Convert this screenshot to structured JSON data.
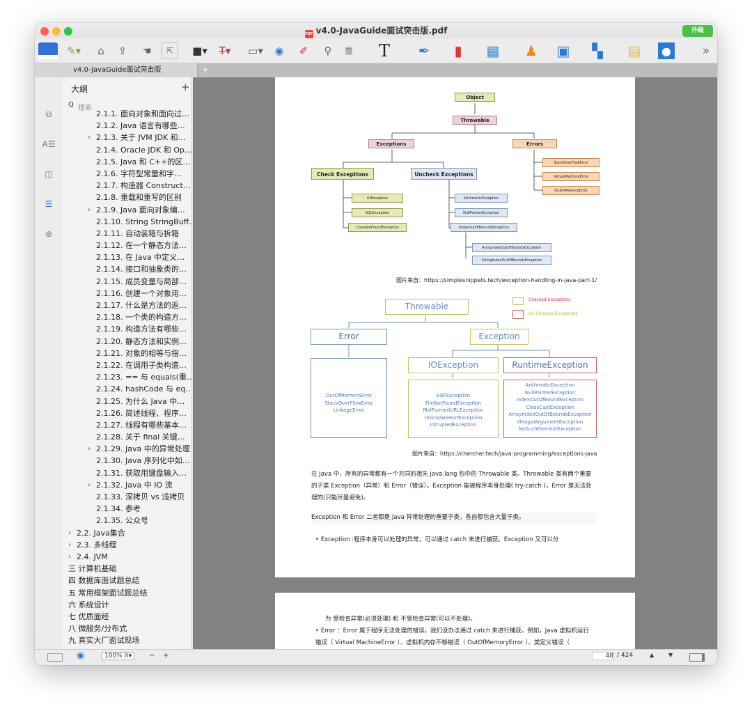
{
  "window": {
    "title": "v4.0-JavaGuide面试突击版.pdf",
    "upgrade": "升级"
  },
  "toolbar": {
    "more": "»",
    "text_tool": "T"
  },
  "tab": {
    "label": "v4.0-JavaGuide面试突击版",
    "plus": "+"
  },
  "sidebar": {
    "outline_title": "大纲",
    "plus": "+",
    "search_placeholder": "搜索",
    "items": [
      {
        "label": "2.1.1. 面向对象和面向过…",
        "indent": 2,
        "chevron": false
      },
      {
        "label": "2.1.2. Java 语言有哪些…",
        "indent": 2,
        "chevron": false
      },
      {
        "label": "2.1.3. 关于 JVM JDK 和…",
        "indent": 2,
        "chevron": true
      },
      {
        "label": "2.1.4. Oracle JDK 和 Op…",
        "indent": 2,
        "chevron": false
      },
      {
        "label": "2.1.5. Java 和 C++的区…",
        "indent": 2,
        "chevron": false
      },
      {
        "label": "2.1.6. 字符型常量和字…",
        "indent": 2,
        "chevron": false
      },
      {
        "label": "2.1.7. 构造器 Construct…",
        "indent": 2,
        "chevron": false
      },
      {
        "label": "2.1.8. 重载和重写的区别",
        "indent": 2,
        "chevron": false
      },
      {
        "label": "2.1.9. Java 面向对象编…",
        "indent": 2,
        "chevron": true
      },
      {
        "label": "2.1.10. String StringBuff…",
        "indent": 2,
        "chevron": false
      },
      {
        "label": "2.1.11. 自动装箱与拆箱",
        "indent": 2,
        "chevron": false
      },
      {
        "label": "2.1.12. 在一个静态方法…",
        "indent": 2,
        "chevron": false
      },
      {
        "label": "2.1.13. 在 Java 中定义…",
        "indent": 2,
        "chevron": false
      },
      {
        "label": "2.1.14. 接口和抽象类的…",
        "indent": 2,
        "chevron": false
      },
      {
        "label": "2.1.15. 成员变量与局部…",
        "indent": 2,
        "chevron": false
      },
      {
        "label": "2.1.16. 创建一个对象用…",
        "indent": 2,
        "chevron": false
      },
      {
        "label": "2.1.17. 什么是方法的返…",
        "indent": 2,
        "chevron": false
      },
      {
        "label": "2.1.18. 一个类的构造方…",
        "indent": 2,
        "chevron": false
      },
      {
        "label": "2.1.19. 构造方法有哪些…",
        "indent": 2,
        "chevron": false
      },
      {
        "label": "2.1.20. 静态方法和实例…",
        "indent": 2,
        "chevron": false
      },
      {
        "label": "2.1.21. 对象的相等与指…",
        "indent": 2,
        "chevron": false
      },
      {
        "label": "2.1.22. 在调用子类构造…",
        "indent": 2,
        "chevron": false
      },
      {
        "label": "2.1.23. == 与 equals(重…",
        "indent": 2,
        "chevron": false
      },
      {
        "label": "2.1.24. hashCode 与 eq…",
        "indent": 2,
        "chevron": false
      },
      {
        "label": "2.1.25. 为什么 Java 中…",
        "indent": 2,
        "chevron": false
      },
      {
        "label": "2.1.26. 简述线程、程序…",
        "indent": 2,
        "chevron": false
      },
      {
        "label": "2.1.27. 线程有哪些基本…",
        "indent": 2,
        "chevron": false
      },
      {
        "label": "2.1.28. 关于 final 关键…",
        "indent": 2,
        "chevron": false
      },
      {
        "label": "2.1.29. Java 中的异常处理",
        "indent": 2,
        "chevron": true
      },
      {
        "label": "2.1.30. Java 序列化中如…",
        "indent": 2,
        "chevron": false
      },
      {
        "label": "2.1.31. 获取用键盘输入…",
        "indent": 2,
        "chevron": false
      },
      {
        "label": "2.1.32. Java 中 IO 流",
        "indent": 2,
        "chevron": true
      },
      {
        "label": "2.1.33. 深拷贝 vs 浅拷贝",
        "indent": 2,
        "chevron": false
      },
      {
        "label": "2.1.34. 参考",
        "indent": 2,
        "chevron": false
      },
      {
        "label": "2.1.35. 公众号",
        "indent": 2,
        "chevron": false
      },
      {
        "label": "2.2. Java集合",
        "indent": 1,
        "chevron": true
      },
      {
        "label": "2.3. 多线程",
        "indent": 1,
        "chevron": true
      },
      {
        "label": "2.4. JVM",
        "indent": 1,
        "chevron": true
      },
      {
        "label": "三 计算机基础",
        "indent": 0,
        "chevron": true
      },
      {
        "label": "四 数据库面试题总结",
        "indent": 0,
        "chevron": true
      },
      {
        "label": "五 常用框架面试题总结",
        "indent": 0,
        "chevron": true
      },
      {
        "label": "六 系统设计",
        "indent": 0,
        "chevron": true
      },
      {
        "label": "七 优质面经",
        "indent": 0,
        "chevron": true
      },
      {
        "label": "八 微服务/分布式",
        "indent": 0,
        "chevron": false
      },
      {
        "label": "九 真实大厂面试现场",
        "indent": 0,
        "chevron": true
      }
    ]
  },
  "diagram1": {
    "object": "Object",
    "throwable": "Throwable",
    "exceptions": "Exceptions",
    "errors": "Errors",
    "checked": "Check Exceptions",
    "unchecked": "Uncheck Exceptions",
    "err_items": [
      "StackOverFlowError",
      "VirtualMachineError",
      "OutOfMemoryError"
    ],
    "checked_items": [
      "IOException",
      "SQLException",
      "ClassNotFoundException"
    ],
    "unchecked_items": [
      "ArithmeticException",
      "NullPointerException",
      "IndexOutOfBoundsException"
    ],
    "index_items": [
      "ArrayIndexOutOfBoundsExcpetion",
      "StringIndexOutOfBoundsExcpetion"
    ],
    "caption": "图片来自：https://simplesnippets.tech/exception-handling-in-java-part-1/"
  },
  "diagram2": {
    "throwable": "Throwable",
    "error": "Error",
    "exception": "Exception",
    "ioexception": "IOException",
    "runtime": "RuntimeException",
    "legend_checked": "Checked Exceptions",
    "legend_unchecked": "Un-Checked Exceptions",
    "error_list": [
      "OutOfMemoryError",
      "StackOverFlowError",
      "LinkageError"
    ],
    "io_list": [
      "EOFException",
      "FileNotFoundException",
      "MalFormedURLException",
      "UnknownHostException",
      "IntruptedException"
    ],
    "runtime_list": [
      "ArithmaticException",
      "NullPointerException",
      "IndexOutOfBoundException",
      "ClassCastException",
      "ArrayIndexOutOfBoundsException",
      "IlleagalArgumentException",
      "NoSuchElementException"
    ],
    "caption": "图片来自：https://chercher.tech/java-programming/exceptions-java"
  },
  "text": {
    "p1": "在 Java 中，所有的异常都有一个共同的祖先 java.lang 包中的 Throwable 类。Throwable 类有两个重要的子类 Exception（异常）和 Error（错误）。Exception 能被程序本身处理( try-catch )，Error 是无法处理的(只能尽量避免)。",
    "p2": "Exception 和 Error 二者都是 Java 异常处理的重要子类，各自都包含大量子类。",
    "p3": "• Exception :程序本身可以处理的异常，可以通过 catch 来进行捕获。Exception 又可以分",
    "p4": "为 受检查异常(必须处理) 和 不受检查异常(可以不处理)。",
    "p5": "• Error ：Error 属于程序无法处理的错误，我们没办法通过 catch 来进行捕获。例如，Java 虚拟机运行错误（ Virtual MachineError ）、虚拟机内存不够错误（ OutOfMemoryError ）、类定义错误（ NoClassDefFoundError ）等。这些异常发生时，Java"
  },
  "status": {
    "zoom": "100%",
    "zoom_menu": "It",
    "minus": "−",
    "plus": "+",
    "page": "48",
    "total": "/ 424"
  }
}
